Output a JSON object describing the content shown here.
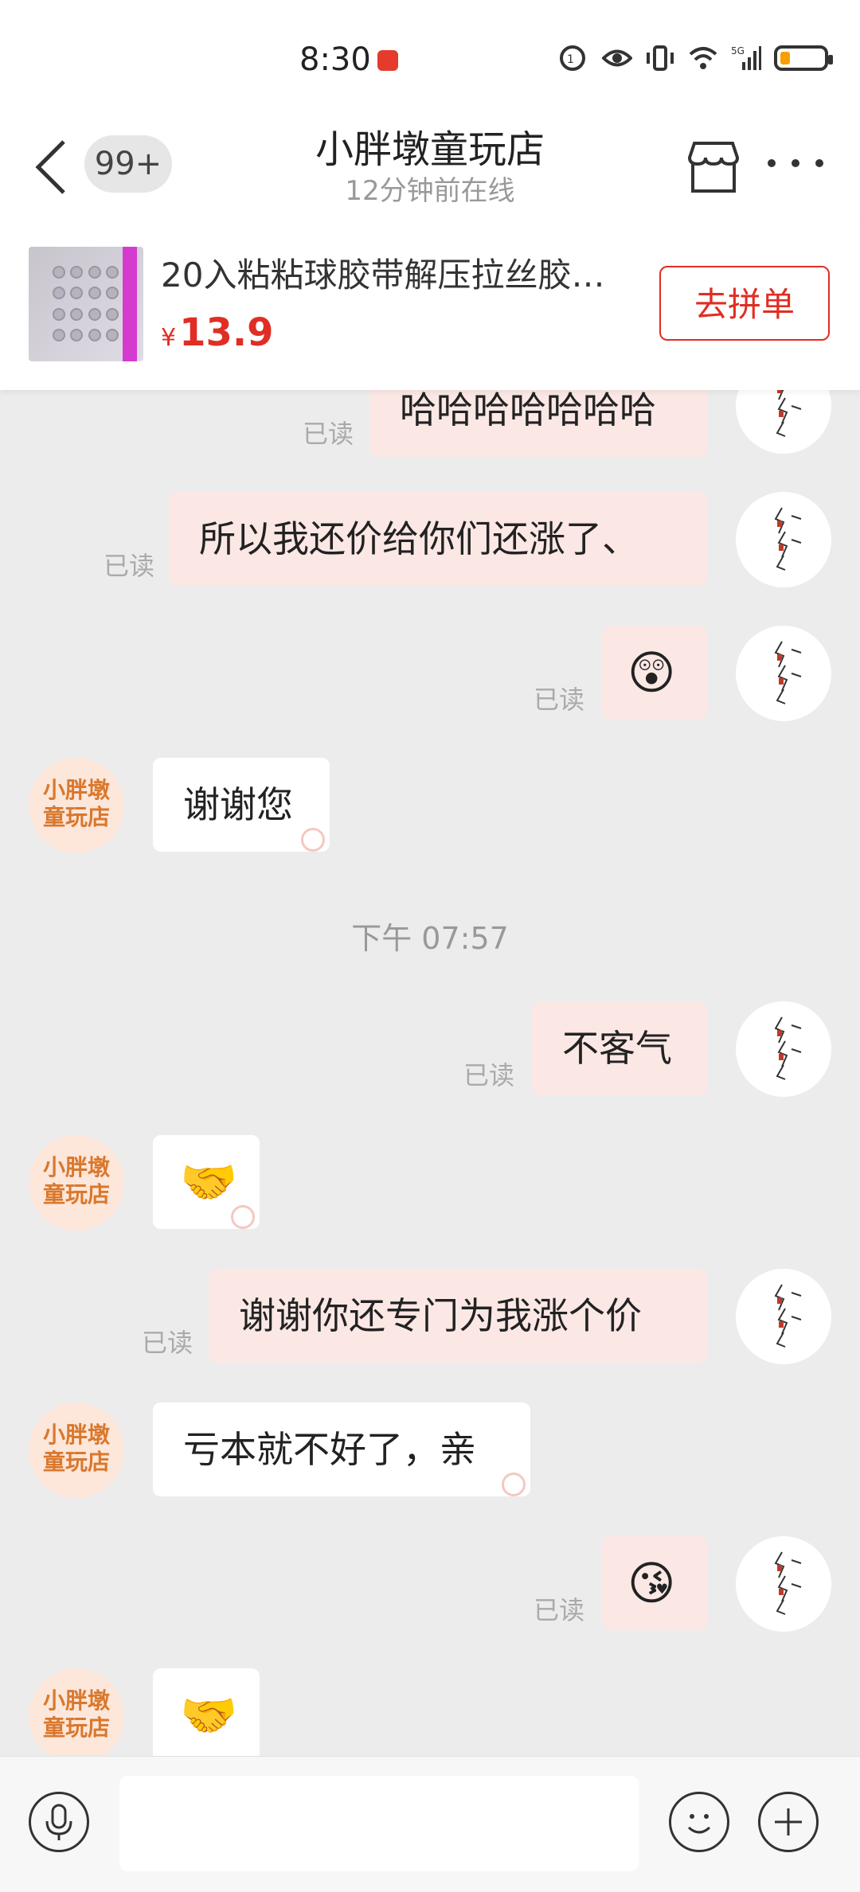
{
  "status": {
    "time": "8:30",
    "network": "5G"
  },
  "header": {
    "unread_badge": "99+",
    "shop_name": "小胖墩童玩店",
    "online_status": "12分钟前在线"
  },
  "product": {
    "title": "20入粘粘球胶带解压拉丝胶…",
    "currency": "¥",
    "price": "13.9",
    "button": "去拼单"
  },
  "shop_avatar_text": "小胖墩童玩店",
  "messages": [
    {
      "side": "mine",
      "text": "哈哈哈哈哈哈哈",
      "read": "已读"
    },
    {
      "side": "mine",
      "text": "所以我还价给你们还涨了、",
      "read": "已读"
    },
    {
      "side": "mine",
      "emoji": "😲",
      "read": "已读"
    },
    {
      "side": "theirs",
      "text": "谢谢您"
    },
    {
      "timestamp": "下午 07:57"
    },
    {
      "side": "mine",
      "text": "不客气",
      "read": "已读"
    },
    {
      "side": "theirs",
      "emoji": "🤝"
    },
    {
      "side": "mine",
      "text": "谢谢你还专门为我涨个价",
      "read": "已读"
    },
    {
      "side": "theirs",
      "text": "亏本就不好了，亲"
    },
    {
      "side": "mine",
      "emoji": "😘",
      "read": "已读"
    },
    {
      "side": "theirs",
      "emoji": "🤝"
    }
  ]
}
